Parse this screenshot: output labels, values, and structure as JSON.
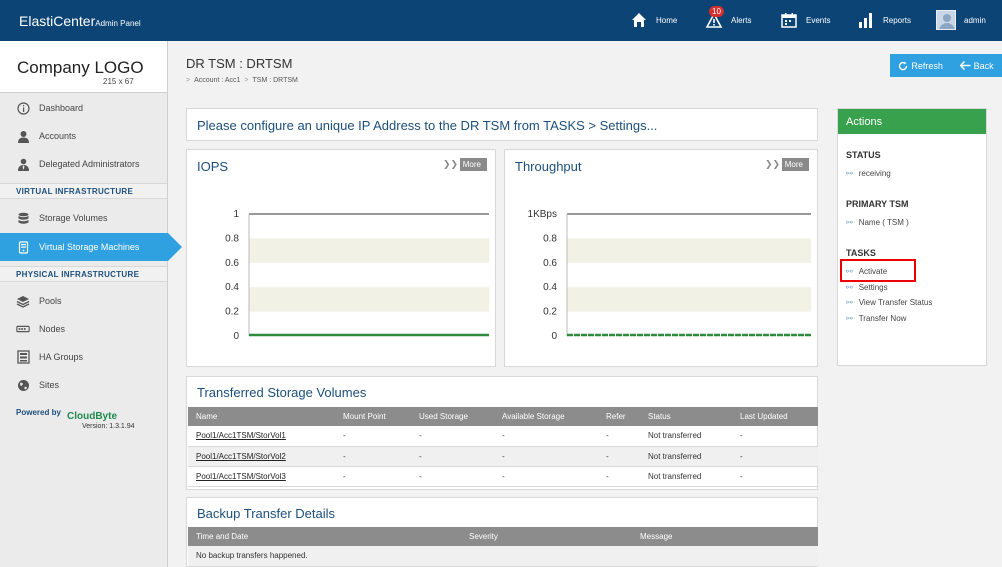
{
  "header": {
    "brand": "ElastiCenter",
    "brand_sub": "Admin Panel",
    "nav": [
      {
        "label": "Home",
        "icon": "home-icon"
      },
      {
        "label": "Alerts",
        "icon": "alert-icon",
        "badge": "10"
      },
      {
        "label": "Events",
        "icon": "calendar-icon"
      },
      {
        "label": "Reports",
        "icon": "bar-chart-icon"
      },
      {
        "label": "admin",
        "icon": "avatar"
      }
    ]
  },
  "sidebar": {
    "logo_text": "Company LOGO",
    "logo_size": "215 x 67",
    "items": [
      {
        "label": "Dashboard",
        "icon": "info-icon"
      },
      {
        "label": "Accounts",
        "icon": "user-icon"
      },
      {
        "label": "Delegated Administrators",
        "icon": "admin-icon"
      }
    ],
    "section_virtual": "VIRTUAL INFRASTRUCTURE",
    "virtual_items": [
      {
        "label": "Storage Volumes",
        "icon": "database-icon"
      },
      {
        "label": "Virtual Storage Machines",
        "icon": "vsm-icon"
      }
    ],
    "section_physical": "PHYSICAL INFRASTRUCTURE",
    "physical_items": [
      {
        "label": "Pools",
        "icon": "layers-icon"
      },
      {
        "label": "Nodes",
        "icon": "node-icon"
      },
      {
        "label": "HA Groups",
        "icon": "rack-icon"
      },
      {
        "label": "Sites",
        "icon": "globe-icon"
      }
    ],
    "powered_by": "Powered by",
    "cb_logo": "CloudByte",
    "cb_version": "Version: 1.3.1.94"
  },
  "page": {
    "title": "DR TSM : DRTSM",
    "breadcrumb": [
      "Account : Acc1",
      "TSM : DRTSM"
    ],
    "refresh_label": "Refresh",
    "back_label": "Back",
    "notice": "Please configure an unique IP Address to the DR TSM from TASKS > Settings..."
  },
  "charts": {
    "more_label": "More",
    "iops_title": "IOPS",
    "thru_title": "Throughput",
    "iops_ticks": [
      "1",
      "0.8",
      "0.6",
      "0.4",
      "0.2",
      "0"
    ],
    "thru_ticks": [
      "1KBps",
      "0.8",
      "0.6",
      "0.4",
      "0.2",
      "0"
    ]
  },
  "chart_data": [
    {
      "type": "line",
      "title": "IOPS",
      "ylim": [
        0,
        1
      ],
      "yticks": [
        0,
        0.2,
        0.4,
        0.6,
        0.8,
        1
      ],
      "series": [
        {
          "values": [
            0,
            0,
            0,
            0,
            0,
            0,
            0,
            0,
            0,
            0
          ]
        }
      ]
    },
    {
      "type": "line",
      "title": "Throughput",
      "ylabel_unit": "KBps",
      "ylim": [
        0,
        1
      ],
      "yticks": [
        0,
        0.2,
        0.4,
        0.6,
        0.8,
        1
      ],
      "series": [
        {
          "values": [
            0,
            0,
            0,
            0,
            0,
            0,
            0,
            0,
            0,
            0
          ]
        }
      ]
    }
  ],
  "volumes": {
    "title": "Transferred Storage Volumes",
    "columns": [
      "Name",
      "Mount Point",
      "Used Storage",
      "Available Storage",
      "Refer",
      "Status",
      "Last Updated"
    ],
    "rows": [
      [
        "Pool1/Acc1TSM/StorVol1",
        "-",
        "-",
        "-",
        "-",
        "Not transferred",
        "-"
      ],
      [
        "Pool1/Acc1TSM/StorVol2",
        "-",
        "-",
        "-",
        "-",
        "Not transferred",
        "-"
      ],
      [
        "Pool1/Acc1TSM/StorVol3",
        "-",
        "-",
        "-",
        "-",
        "Not transferred",
        "-"
      ]
    ]
  },
  "backup": {
    "title": "Backup Transfer Details",
    "columns": [
      "Time and Date",
      "Severity",
      "Message"
    ],
    "empty": "No backup transfers happened."
  },
  "actions": {
    "title": "Actions",
    "status_label": "STATUS",
    "status_value": "receiving",
    "primary_label": "PRIMARY TSM",
    "primary_value": "Name ( TSM )",
    "tasks_label": "TASKS",
    "tasks": [
      "Activate",
      "Settings",
      "View Transfer Status",
      "Transfer Now"
    ]
  }
}
